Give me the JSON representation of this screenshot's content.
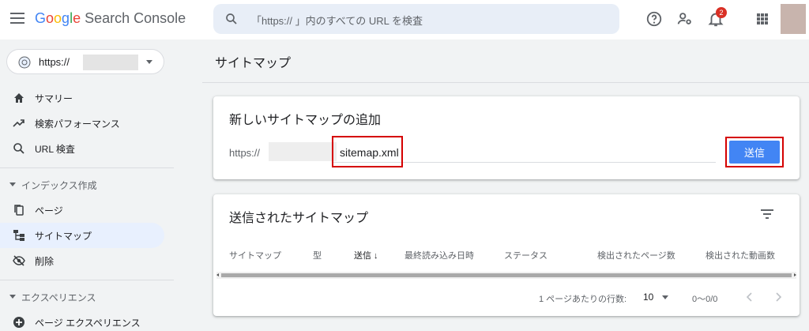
{
  "header": {
    "brand": {
      "G": "G",
      "o1": "o",
      "o2": "o",
      "g": "g",
      "l": "l",
      "e": "e",
      "rest": " Search Console"
    },
    "search_placeholder": "「https://                      」内のすべての URL を検査",
    "notification_count": "2"
  },
  "sidebar": {
    "property": "https://",
    "items": [
      {
        "label": "サマリー",
        "icon": "home-icon"
      },
      {
        "label": "検索パフォーマンス",
        "icon": "trending-up-icon"
      },
      {
        "label": "URL 検査",
        "icon": "search-icon"
      }
    ],
    "section_index": "インデックス作成",
    "index_items": [
      {
        "label": "ページ",
        "icon": "pages-icon"
      },
      {
        "label": "サイトマップ",
        "icon": "sitemap-icon"
      },
      {
        "label": "削除",
        "icon": "removals-icon"
      }
    ],
    "section_experience": "エクスペリエンス",
    "experience_items": [
      {
        "label": "ページ エクスペリエンス",
        "icon": "page-experience-icon"
      }
    ]
  },
  "main": {
    "page_title": "サイトマップ",
    "add_card": {
      "title": "新しいサイトマップの追加",
      "prefix": "https://",
      "input_value": "sitemap.xml",
      "submit_label": "送信"
    },
    "submitted_card": {
      "title": "送信されたサイトマップ",
      "columns": [
        "サイトマップ",
        "型",
        "送信 ↓",
        "最終読み込み日時",
        "ステータス",
        "検出されたページ数",
        "検出された動画数"
      ],
      "rows_per_page_label": "1 ページあたりの行数:",
      "rows_per_page": "10",
      "range": "0〜0/0"
    }
  },
  "colors": {
    "accent": "#4285f4",
    "highlight": "#d50000",
    "active_nav": "#e8f0fe"
  }
}
